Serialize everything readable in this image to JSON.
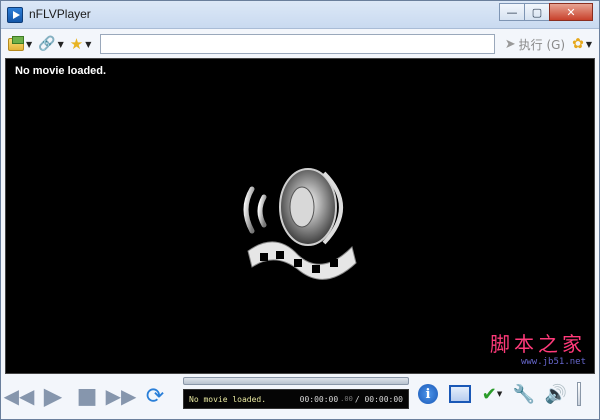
{
  "window": {
    "title": "nFLVPlayer",
    "minimize_glyph": "—",
    "restore_glyph": "▢",
    "close_glyph": "✕"
  },
  "toolbar": {
    "open_icon": "folder-open-icon",
    "link_icon": "link-icon",
    "favorites_icon": "star-icon",
    "url_value": "",
    "execute_label": "执行 (G)",
    "tips_icon": "bulb-icon"
  },
  "video": {
    "status": "No movie loaded.",
    "logo_icon": "speaker-film-logo"
  },
  "watermark": {
    "main": "脚本之家",
    "sub": "www.jb51.net"
  },
  "controls": {
    "progress": 0,
    "lcd_message": "No movie loaded.",
    "elapsed": "00:00:00",
    "elapsed_frac": ".00",
    "duration": "/ 00:00:00"
  },
  "colors": {
    "accent": "#1a58b6",
    "lcd_text": "#e8e8a0",
    "watermark": "#ff3a7a"
  }
}
